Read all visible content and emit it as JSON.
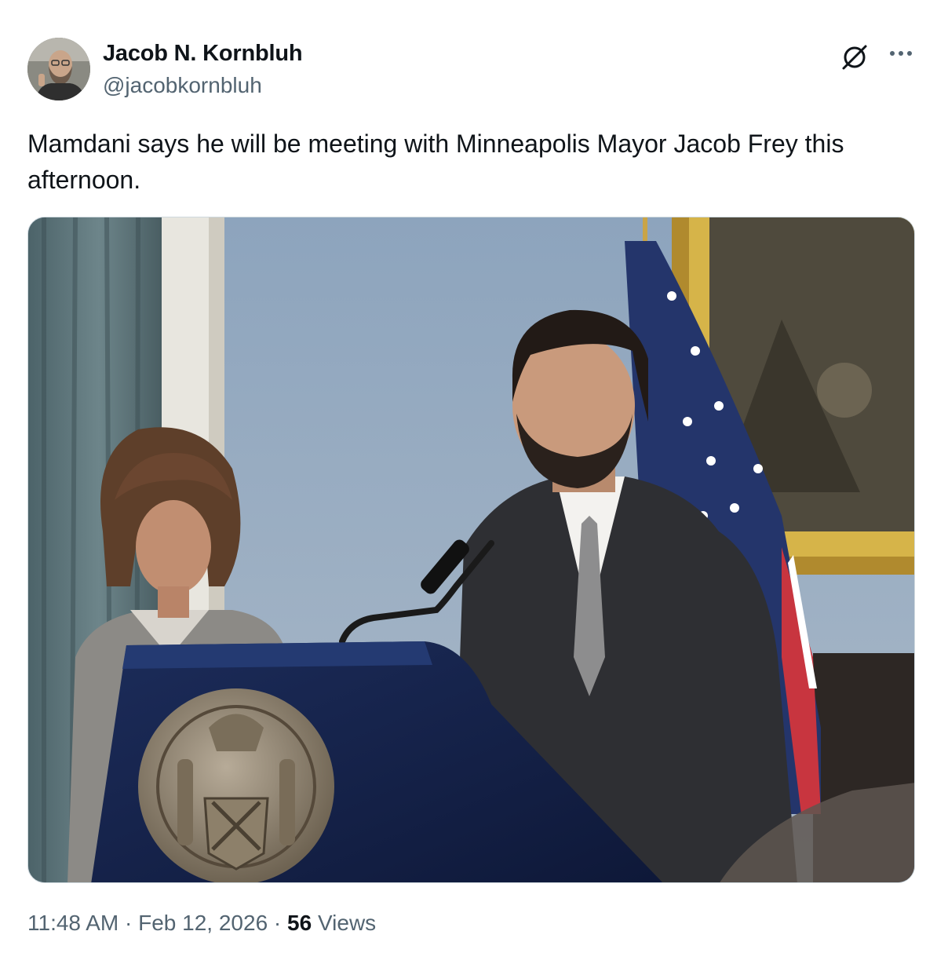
{
  "author": {
    "name": "Jacob N. Kornbluh",
    "handle": "@jacobkornbluh"
  },
  "header_icons": {
    "grok": "grok-icon",
    "more": "more-options-icon"
  },
  "tweet": {
    "text": "Mamdani says he will be meeting with Minneapolis Mayor Jacob Frey this afternoon."
  },
  "meta": {
    "time": "11:48 AM",
    "separator_1": " · ",
    "date": "Feb 12, 2026",
    "separator_2": " · ",
    "views_count": "56",
    "views_label": " Views"
  },
  "colors": {
    "text_primary": "#0f1419",
    "text_secondary": "#536471",
    "border": "#cfd9de"
  }
}
